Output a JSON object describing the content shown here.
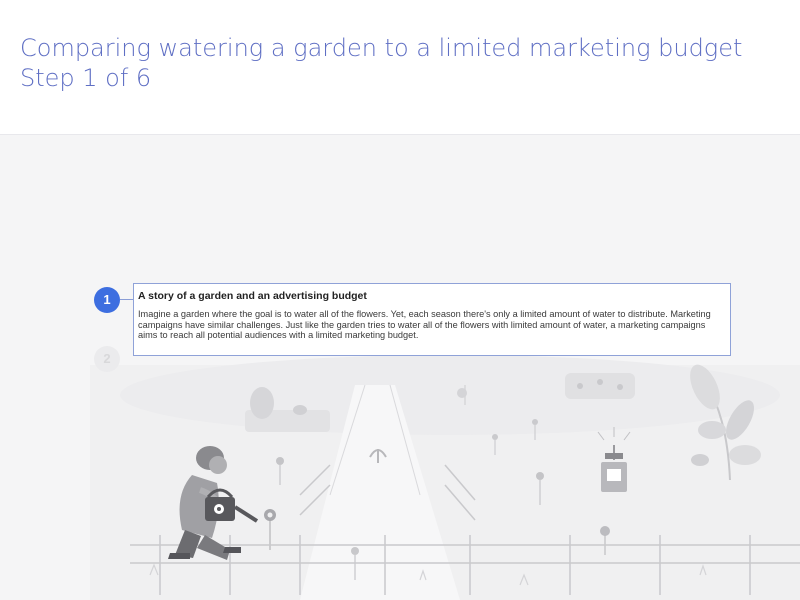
{
  "header": {
    "title_line1": "Comparing watering a  garden to a limited marketing budget",
    "title_line2": "Step 1 of 6",
    "color": "#5f6fc4"
  },
  "steps": [
    {
      "number": "1",
      "active": true,
      "title": "A story of a garden and an advertising budget",
      "body": "Imagine a garden where the goal is to water all of the flowers. Yet, each season there's only a limited amount of water to distribute. Marketing campaigns have similar challenges. Just like the garden tries to water all of the flowers with limited amount of water, a marketing campaigns aims to reach all potential audiences with a limited marketing budget."
    },
    {
      "number": "2",
      "active": false
    }
  ],
  "colors": {
    "accent": "#3d6ee0",
    "card_border": "#8fa2d8",
    "stage_bg": "#f5f5f6"
  },
  "illustration": {
    "icons": [
      "gardener-figure",
      "watering-can-icon",
      "flower-icons",
      "fence",
      "bush-icons",
      "leafy-plant-icon",
      "sprinkler-icon"
    ]
  }
}
